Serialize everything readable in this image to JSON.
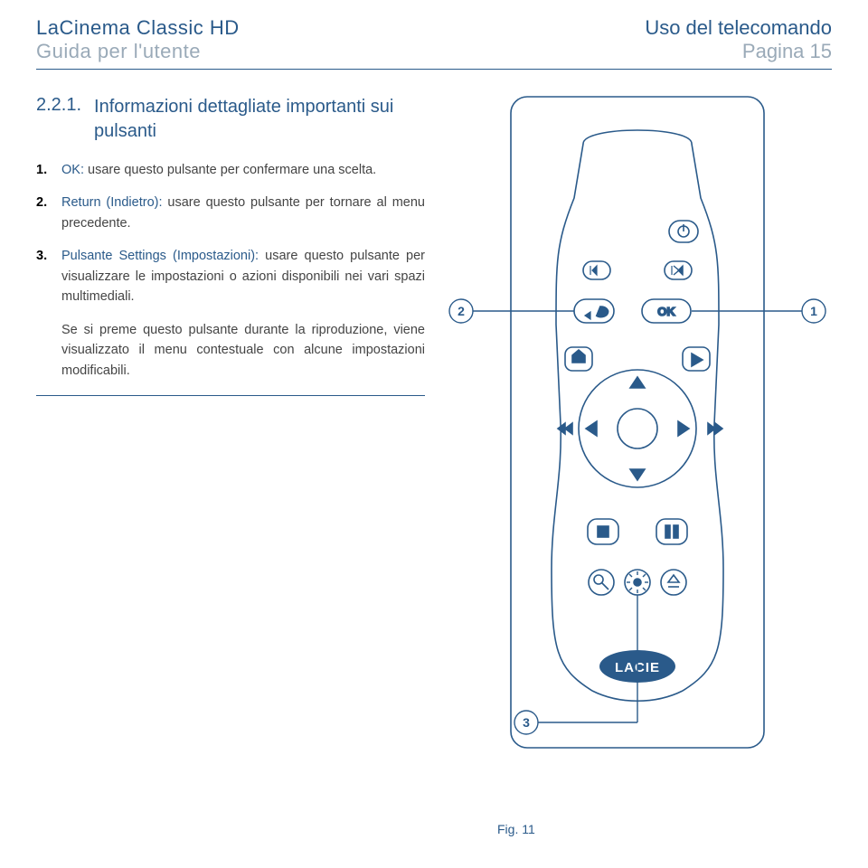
{
  "header": {
    "product": "LaCinema Classic HD",
    "guide": "Guida per l'utente",
    "section": "Uso del telecomando",
    "page": "Pagina 15"
  },
  "section": {
    "number": "2.2.1.",
    "title": "Informazioni dettagliate importanti sui pulsanti"
  },
  "items": [
    {
      "num": "1.",
      "label": "OK:",
      "text": " usare questo pulsante per confermare una scelta."
    },
    {
      "num": "2.",
      "label": "Return (Indietro):",
      "text": " usare questo pulsante per tornare al menu precedente."
    },
    {
      "num": "3.",
      "label": "Pulsante Settings (Impostazioni):",
      "text": " usare questo pulsante per visualizzare le impostazioni o azioni disponibili nei vari spazi multimediali."
    }
  ],
  "note": "Se si preme questo pulsante durante la riproduzione, viene visualizzato il menu contestuale con alcune impostazioni modificabili.",
  "figure": {
    "callouts": {
      "c1": "1",
      "c2": "2",
      "c3": "3"
    },
    "ok_label": "OK",
    "brand": "LACIE",
    "caption": "Fig. 11"
  }
}
